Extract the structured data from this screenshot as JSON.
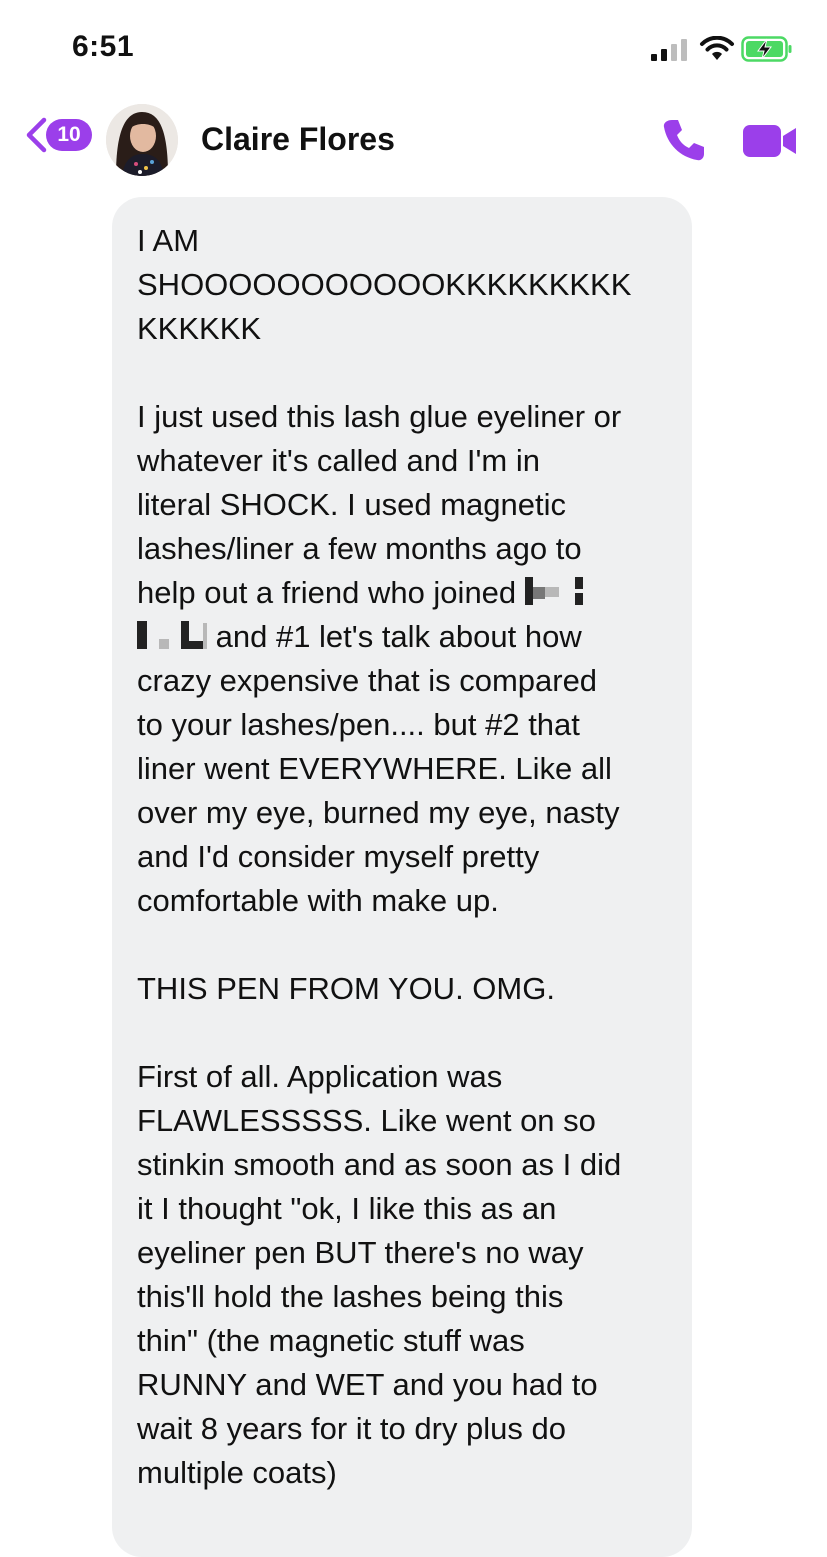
{
  "status_bar": {
    "time": "6:51"
  },
  "header": {
    "back_count": "10",
    "contact_name": "Claire Flores"
  },
  "message": {
    "p1": "I AM\nSHOOOOOOOOOOOKKKKKKKKK\nKKKKKK",
    "p2a": "I just used this lash glue eyeliner or\nwhatever it's called and I'm in\nliteral SHOCK. I used magnetic\nlashes/liner a few months ago to\nhelp out a friend who joined ",
    "p2b": " and #1 let's talk about how\ncrazy expensive that is compared\nto your lashes/pen.... but #2 that\nliner went EVERYWHERE. Like all\nover my eye, burned my eye, nasty\nand I'd consider myself pretty\ncomfortable with make up.",
    "p3": "THIS PEN FROM YOU. OMG.",
    "p4": "First of all. Application was\nFLAWLESSSSS. Like went on so\nstinkin smooth and as soon as I did\nit I thought \"ok, I like this as an\neyeliner pen BUT there's no way\nthis'll hold the lashes being this\nthin\" (the magnetic stuff was\nRUNNY and WET and you had to\nwait 8 years for it to dry plus do\nmultiple coats)"
  },
  "colors": {
    "accent": "#9b3fea",
    "bubble": "#eff0f1",
    "battery_fill": "#4cd964"
  }
}
